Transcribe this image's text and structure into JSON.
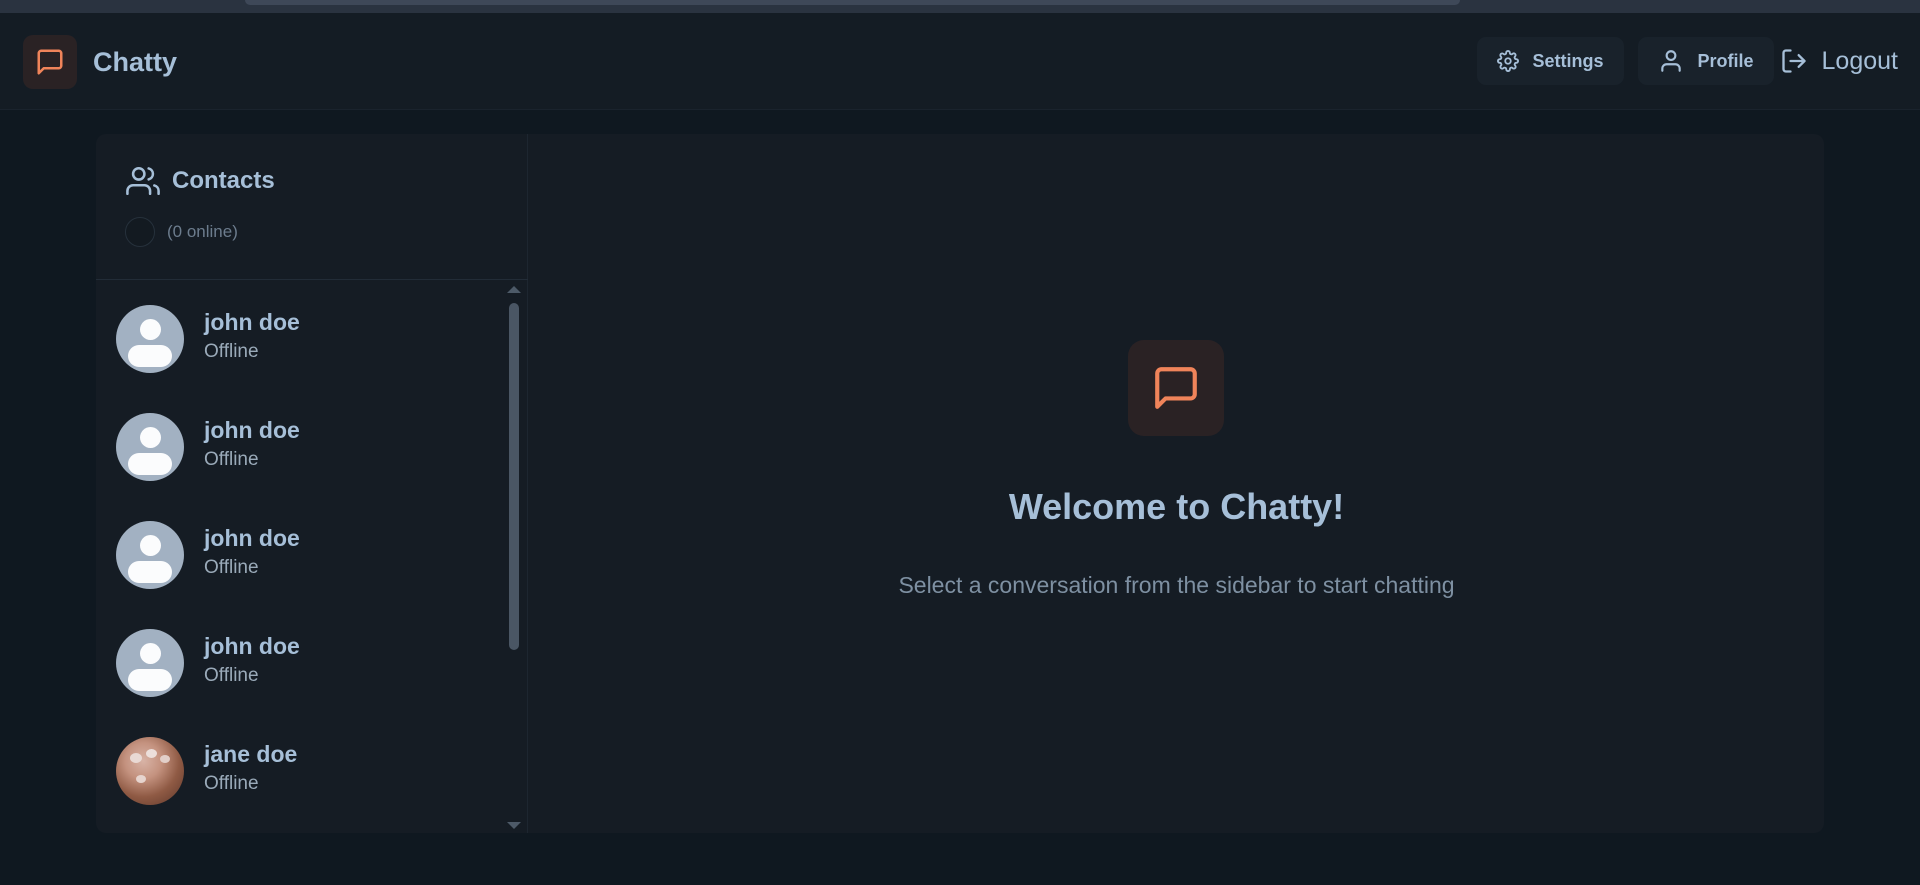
{
  "app": {
    "brand_name": "Chatty",
    "accent_color": "#f0845a",
    "brand_icon": "message-square-icon"
  },
  "nav": {
    "settings_label": "Settings",
    "profile_label": "Profile",
    "logout_label": "Logout"
  },
  "sidebar": {
    "title": "Contacts",
    "online_count": "(0 online)",
    "contacts": [
      {
        "name": "john doe",
        "status": "Offline",
        "avatar": "default-avatar"
      },
      {
        "name": "john doe",
        "status": "Offline",
        "avatar": "default-avatar"
      },
      {
        "name": "john doe",
        "status": "Offline",
        "avatar": "default-avatar"
      },
      {
        "name": "john doe",
        "status": "Offline",
        "avatar": "default-avatar"
      },
      {
        "name": "jane doe",
        "status": "Offline",
        "avatar": "photo-avatar"
      }
    ]
  },
  "main": {
    "welcome_title": "Welcome to Chatty!",
    "welcome_subtitle": "Select a conversation from the sidebar to start chatting"
  }
}
